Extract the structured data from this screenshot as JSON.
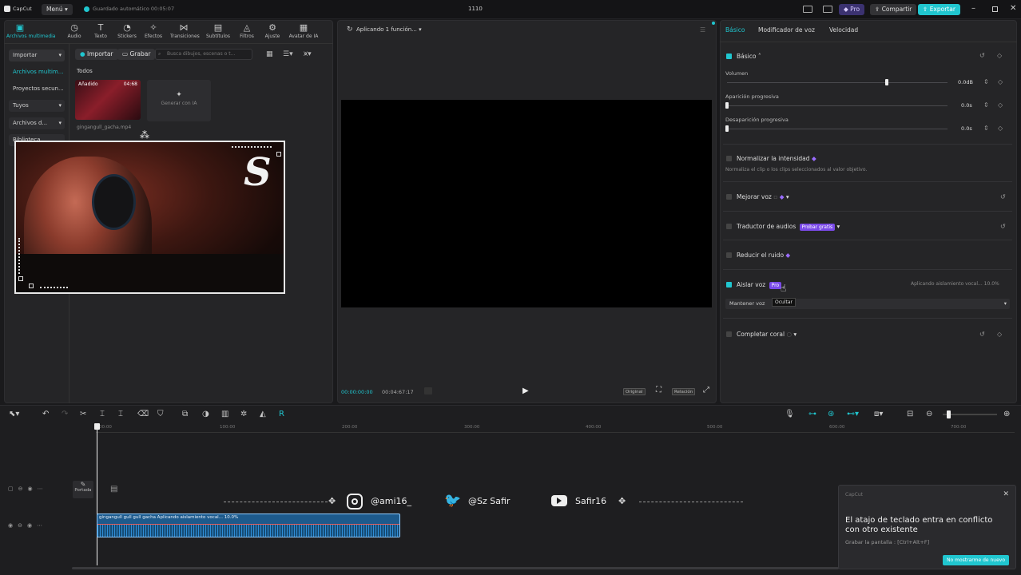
{
  "app": {
    "logo_text": "CapCut",
    "menu_label": "Menú",
    "autosave_text": "Guardado automático 00:05:07",
    "project_title": "1110"
  },
  "topbar": {
    "pro_label": "Pro",
    "share_label": "Compartir",
    "export_label": "Exportar"
  },
  "tools": [
    {
      "label": "Archivos multimedia",
      "icon": "media-icon"
    },
    {
      "label": "Audio",
      "icon": "audio-icon"
    },
    {
      "label": "Texto",
      "icon": "text-icon"
    },
    {
      "label": "Stickers",
      "icon": "sticker-icon"
    },
    {
      "label": "Efectos",
      "icon": "effects-icon"
    },
    {
      "label": "Transiciones",
      "icon": "transitions-icon"
    },
    {
      "label": "Subtítulos",
      "icon": "subtitles-icon"
    },
    {
      "label": "Filtros",
      "icon": "filters-icon"
    },
    {
      "label": "Ajuste",
      "icon": "adjust-icon"
    },
    {
      "label": "Avatar de IA",
      "icon": "avatar-icon"
    }
  ],
  "sidebar": {
    "items": [
      "Importar",
      "Archivos multim...",
      "Proyectos secun...",
      "Tuyos",
      "Archivos d...",
      "Biblioteca"
    ]
  },
  "media": {
    "import_label": "Importar",
    "record_label": "Grabar",
    "search_placeholder": "Busca dibujos, escenas o t...",
    "filter_all": "Todos",
    "clip": {
      "badge": "Añadido",
      "duration": "04:68",
      "filename": "gingangull_gacha.mp4"
    },
    "generate_label": "Generar con IA"
  },
  "overlay": {
    "brand_letter": "S"
  },
  "player": {
    "status": "Aplicando 1 función...",
    "current_time": "00:00:00:00",
    "total_time": "00:04:67:17",
    "ratio_label": "Original",
    "quality_label": "Relación"
  },
  "right_panel": {
    "tabs": [
      "Básico",
      "Modificador de voz",
      "Velocidad"
    ],
    "basic_header": "Básico",
    "volume_label": "Volumen",
    "volume_value": "0.0dB",
    "fade_in_label": "Aparición progresiva",
    "fade_in_value": "0.0s",
    "fade_out_label": "Desaparición progresiva",
    "fade_out_value": "0.0s",
    "normalize_label": "Normalizar la intensidad",
    "normalize_desc": "Normaliza el clip o los clips seleccionados al valor objetivo.",
    "enhance_label": "Mejorar voz",
    "translator_label": "Traductor de audios",
    "translator_badge": "Probar gratis",
    "reduce_noise_label": "Reducir el ruido",
    "isolate_label": "Aislar voz",
    "isolate_badge": "Pro",
    "isolate_status": "Aplicando aislamiento vocal... 10.0%",
    "keep_voice_label": "Mantener voz",
    "tooltip": "Ocultar",
    "complete_label": "Completar coral"
  },
  "timeline": {
    "ruler_labels": [
      "00:00",
      "100:00",
      "200:00",
      "300:00",
      "400:00",
      "500:00",
      "600:00",
      "700:00",
      "800:00"
    ],
    "cover_label": "Portada",
    "audio_clip_label": "gingangull gull gull gacha    Aplicando aislamiento vocal... 10.0%",
    "social": [
      {
        "icon": "instagram-icon",
        "handle": "@ami16_"
      },
      {
        "icon": "twitter-icon",
        "handle": "@Sz Safir"
      },
      {
        "icon": "youtube-icon",
        "handle": "Safir16"
      }
    ]
  },
  "toast": {
    "app_name": "CapCut",
    "title": "El atajo de teclado entra en conflicto con otro existente",
    "detail": "Grabar la pantalla : [Ctrl+Alt+F]",
    "button": "No mostrarme de nuevo"
  }
}
